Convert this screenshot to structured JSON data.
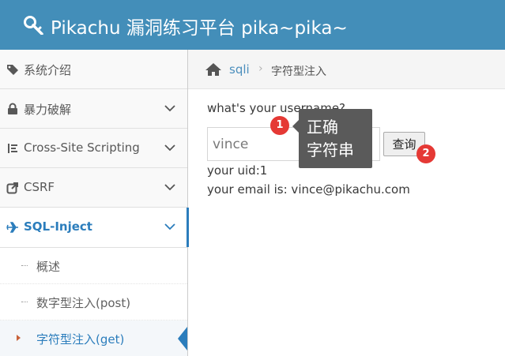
{
  "header": {
    "title": "Pikachu 漏洞练习平台 pika~pika~"
  },
  "sidebar": {
    "items": [
      {
        "label": "系统介绍"
      },
      {
        "label": "暴力破解"
      },
      {
        "label": "Cross-Site Scripting"
      },
      {
        "label": "CSRF"
      },
      {
        "label": "SQL-Inject"
      }
    ],
    "subitems": [
      {
        "label": "概述"
      },
      {
        "label": "数字型注入(post)"
      },
      {
        "label": "字符型注入(get)"
      }
    ]
  },
  "breadcrumb": {
    "section": "sqli",
    "current": "字符型注入"
  },
  "form": {
    "question": "what's your username?",
    "username_value": "vince",
    "submit_label": "查询"
  },
  "result": {
    "uid_line": "your uid:1",
    "email_line": "your email is: vince@pikachu.com"
  },
  "annotation": {
    "badge1": "1",
    "badge2": "2",
    "note_line1": "正确",
    "note_line2": "字符串"
  },
  "colors": {
    "brand": "#438eb9",
    "accent": "#2b7dbc",
    "badge": "#e53935"
  }
}
